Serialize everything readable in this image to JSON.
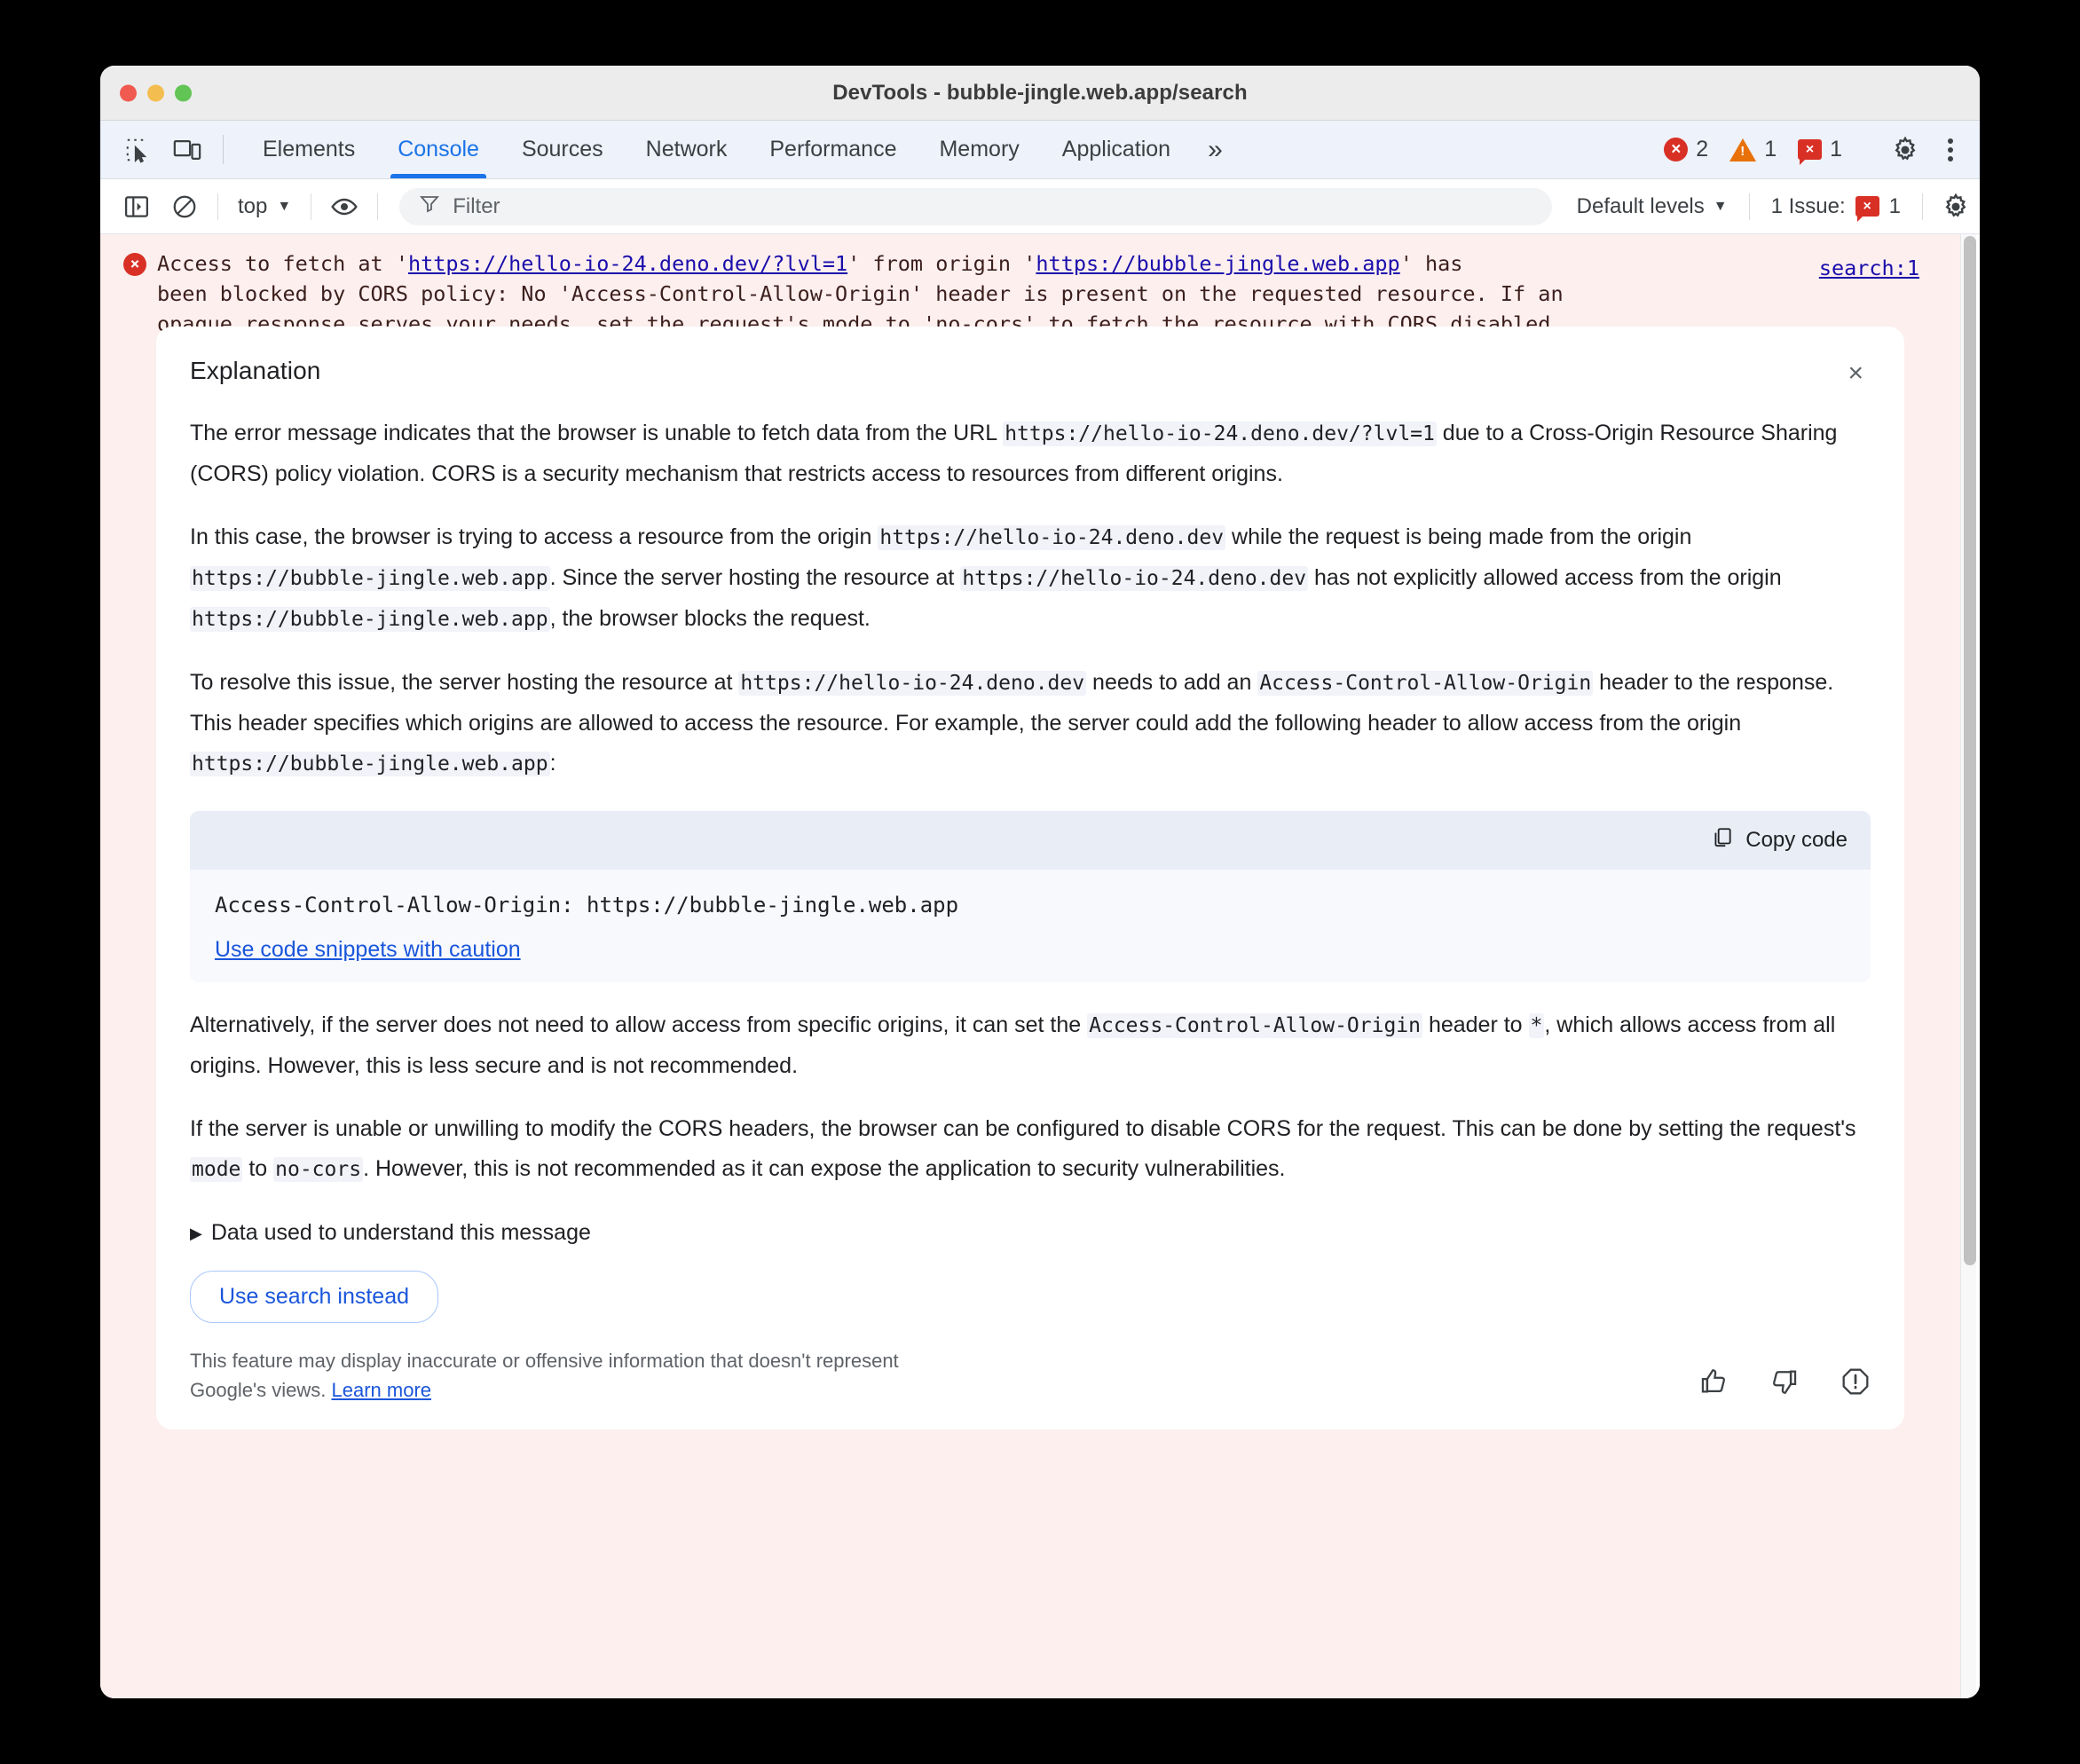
{
  "window": {
    "title": "DevTools - bubble-jingle.web.app/search",
    "traffic_lights": [
      "close",
      "minimize",
      "maximize"
    ]
  },
  "tabbar": {
    "inspect_icon": "inspect-element-icon",
    "device_icon": "device-toolbar-icon",
    "tabs": [
      {
        "label": "Elements",
        "active": false
      },
      {
        "label": "Console",
        "active": true
      },
      {
        "label": "Sources",
        "active": false
      },
      {
        "label": "Network",
        "active": false
      },
      {
        "label": "Performance",
        "active": false
      },
      {
        "label": "Memory",
        "active": false
      },
      {
        "label": "Application",
        "active": false
      }
    ],
    "more_tabs": "»",
    "counters": {
      "errors": "2",
      "warnings": "1",
      "issues": "1",
      "error_glyph": "×",
      "warning_glyph": "!",
      "issue_glyph": "×"
    },
    "settings_icon": "gear-icon",
    "menu_icon": "kebab-menu-icon"
  },
  "consolebar": {
    "sidebar_icon": "console-sidebar-icon",
    "clear_icon": "clear-console-icon",
    "context": "top",
    "context_caret": "▼",
    "eye_icon": "live-expression-icon",
    "filter_icon": "filter-icon",
    "filter_placeholder": "Filter",
    "filter_value": "",
    "levels_label": "Default levels",
    "levels_caret": "▼",
    "issues_label": "1 Issue:",
    "issues_count": "1",
    "issue_glyph": "×",
    "settings_icon": "console-settings-gear-icon"
  },
  "console_message": {
    "badge_glyph": "×",
    "line1_pre": "Access to fetch at '",
    "link1": "https://hello-io-24.deno.dev/?lvl=1",
    "line1_mid": "' from origin '",
    "link2": "https://bubble-jingle.web.app",
    "line1_post": "' has",
    "rest": "been blocked by CORS policy: No 'Access-Control-Allow-Origin' header is present on the requested resource. If an\nopaque response serves your needs, set the request's mode to 'no-cors' to fetch the resource with CORS disabled.",
    "source_link": "search:1"
  },
  "explanation": {
    "title": "Explanation",
    "close_glyph": "×",
    "paragraphs": [
      {
        "id": "p1",
        "parts": [
          {
            "t": "text",
            "v": "The error message indicates that the browser is unable to fetch data from the URL "
          },
          {
            "t": "code",
            "v": "https://hello-io-24.deno.dev/?lvl=1"
          },
          {
            "t": "text",
            "v": " due to a Cross-Origin Resource Sharing (CORS) policy violation. CORS is a security mechanism that restricts access to resources from different origins."
          }
        ]
      },
      {
        "id": "p2",
        "parts": [
          {
            "t": "text",
            "v": "In this case, the browser is trying to access a resource from the origin "
          },
          {
            "t": "code",
            "v": "https://hello-io-24.deno.dev"
          },
          {
            "t": "text",
            "v": " while the request is being made from the origin "
          },
          {
            "t": "code",
            "v": "https://bubble-jingle.web.app"
          },
          {
            "t": "text",
            "v": ". Since the server hosting the resource at "
          },
          {
            "t": "code",
            "v": "https://hello-io-24.deno.dev"
          },
          {
            "t": "text",
            "v": " has not explicitly allowed access from the origin "
          },
          {
            "t": "code",
            "v": "https://bubble-jingle.web.app"
          },
          {
            "t": "text",
            "v": ", the browser blocks the request."
          }
        ]
      },
      {
        "id": "p3",
        "parts": [
          {
            "t": "text",
            "v": "To resolve this issue, the server hosting the resource at "
          },
          {
            "t": "code",
            "v": "https://hello-io-24.deno.dev"
          },
          {
            "t": "text",
            "v": " needs to add an "
          },
          {
            "t": "code",
            "v": "Access-Control-Allow-Origin"
          },
          {
            "t": "text",
            "v": " header to the response. This header specifies which origins are allowed to access the resource. For example, the server could add the following header to allow access from the origin "
          },
          {
            "t": "code",
            "v": "https://bubble-jingle.web.app"
          },
          {
            "t": "text",
            "v": ":"
          }
        ]
      }
    ],
    "snippet": {
      "copy_label": "Copy code",
      "copy_icon": "copy-icon",
      "code": "Access-Control-Allow-Origin: https://bubble-jingle.web.app",
      "caution_link": "Use code snippets with caution"
    },
    "paragraphs_after": [
      {
        "id": "p4",
        "parts": [
          {
            "t": "text",
            "v": "Alternatively, if the server does not need to allow access from specific origins, it can set the "
          },
          {
            "t": "code",
            "v": "Access-Control-Allow-Origin"
          },
          {
            "t": "text",
            "v": " header to "
          },
          {
            "t": "code",
            "v": "*"
          },
          {
            "t": "text",
            "v": ", which allows access from all origins. However, this is less secure and is not recommended."
          }
        ]
      },
      {
        "id": "p5",
        "parts": [
          {
            "t": "text",
            "v": "If the server is unable or unwilling to modify the CORS headers, the browser can be configured to disable CORS for the request. This can be done by setting the request's "
          },
          {
            "t": "code",
            "v": "mode"
          },
          {
            "t": "text",
            "v": " to "
          },
          {
            "t": "code",
            "v": "no-cors"
          },
          {
            "t": "text",
            "v": ". However, this is not recommended as it can expose the application to security vulnerabilities."
          }
        ]
      }
    ],
    "disclosure": {
      "triangle": "▶",
      "label": "Data used to understand this message"
    },
    "action_button": "Use search instead",
    "disclaimer": {
      "text": "This feature may display inaccurate or offensive information that doesn't represent Google's views. ",
      "link": "Learn more"
    },
    "feedback": {
      "thumbs_up": "thumb-up-icon",
      "thumbs_down": "thumb-down-icon",
      "report": "report-icon"
    }
  },
  "colors": {
    "accent": "#1a73e8",
    "error": "#d93025",
    "warning": "#e8710a",
    "error_bg": "#fcefee",
    "link": "#1a56db"
  }
}
